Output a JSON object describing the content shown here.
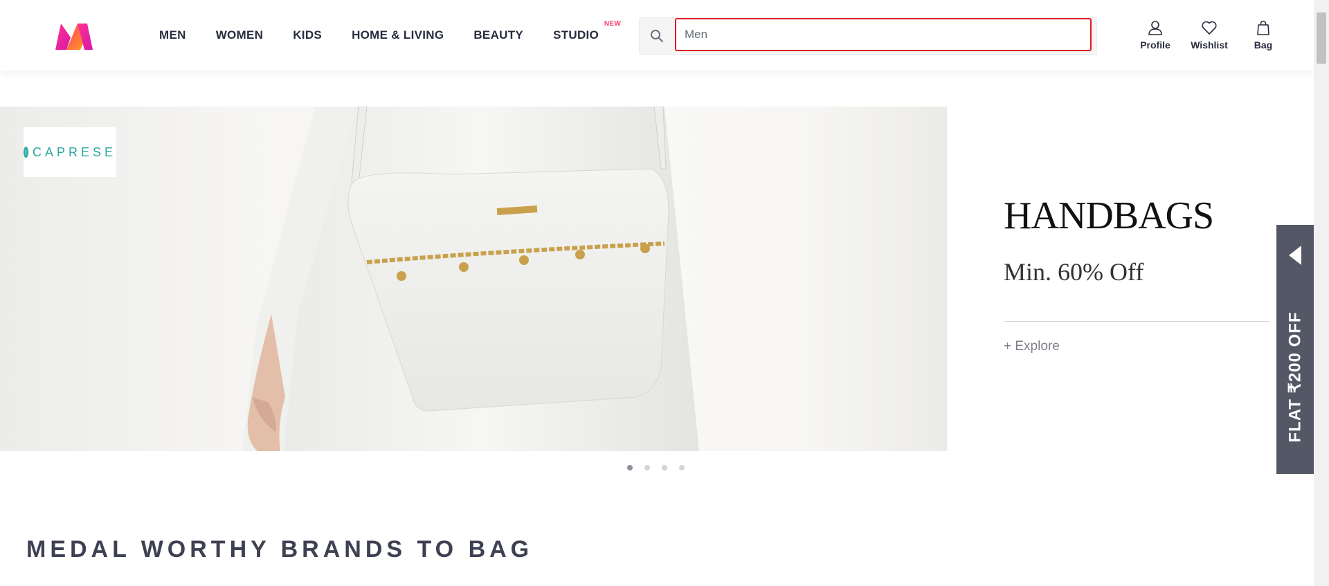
{
  "colors": {
    "accent": "#ff3f6c",
    "search_border": "#e11b23",
    "side_tab_bg": "#535766",
    "brand_teal": "#2aa6a0"
  },
  "header": {
    "logo_icon": "myntra-logo",
    "nav": [
      {
        "label": "MEN"
      },
      {
        "label": "WOMEN"
      },
      {
        "label": "KIDS"
      },
      {
        "label": "HOME & LIVING"
      },
      {
        "label": "BEAUTY"
      },
      {
        "label": "STUDIO",
        "badge": "NEW"
      }
    ],
    "search": {
      "value": "Men",
      "icon": "search-icon"
    },
    "actions": [
      {
        "label": "Profile",
        "icon": "profile-icon"
      },
      {
        "label": "Wishlist",
        "icon": "heart-icon"
      },
      {
        "label": "Bag",
        "icon": "bag-icon"
      }
    ]
  },
  "banner": {
    "brand": "CAPRESE",
    "title": "HANDBAGS",
    "subtitle": "Min. 60% Off",
    "cta": "+ Explore",
    "slide_count": 4,
    "active_slide": 1
  },
  "side_tab": {
    "text": "FLAT ₹200 OFF",
    "icon": "chevron-left-icon"
  },
  "section": {
    "title": "MEDAL WORTHY BRANDS TO BAG"
  }
}
